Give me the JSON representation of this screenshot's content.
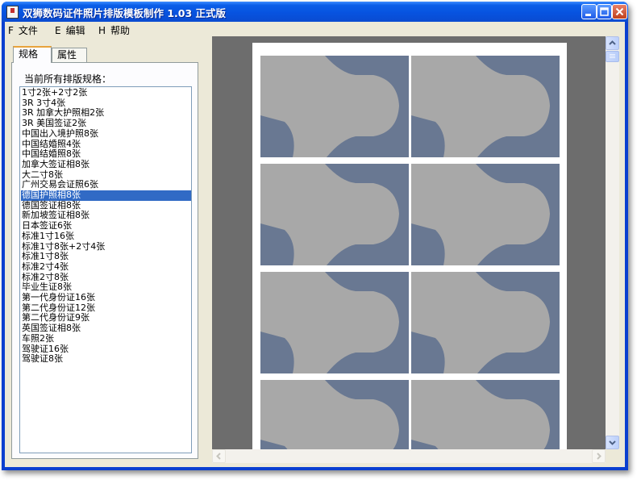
{
  "window": {
    "title": "双狮数码证件照片排版模板制作 1.03 正式版"
  },
  "menu": [
    {
      "key": "F",
      "label": "文件"
    },
    {
      "key": "E",
      "label": "编辑"
    },
    {
      "key": "H",
      "label": "帮助"
    }
  ],
  "tabs": [
    {
      "label": "规格",
      "active": true
    },
    {
      "label": "属性",
      "active": false
    }
  ],
  "list_title": "当前所有排版规格：",
  "specs": [
    "1寸2张+2寸2张",
    "3R 3寸4张",
    "3R 加拿大护照相2张",
    "3R 美国签证2张",
    "中国出入境护照8张",
    "中国结婚照4张",
    "中国结婚照8张",
    "加拿大签证相8张",
    "大二寸8张",
    "广州交易会证照6张",
    "德国护照相8张",
    "德国签证相8张",
    "新加坡签证相8张",
    "日本签证6张",
    "标准1寸16张",
    "标准1寸8张+2寸4张",
    "标准1寸8张",
    "标准2寸4张",
    "标准2寸8张",
    "毕业生证8张",
    "第一代身份证16张",
    "第二代身份证12张",
    "第二代身份证9张",
    "英国签证相8张",
    "车照2张",
    "驾驶证16张",
    "驾驶证8张"
  ],
  "selected_index": 10,
  "colors": {
    "photo_background": "#697892",
    "silhouette": "#a8a8a8",
    "selection": "#316ac5"
  }
}
